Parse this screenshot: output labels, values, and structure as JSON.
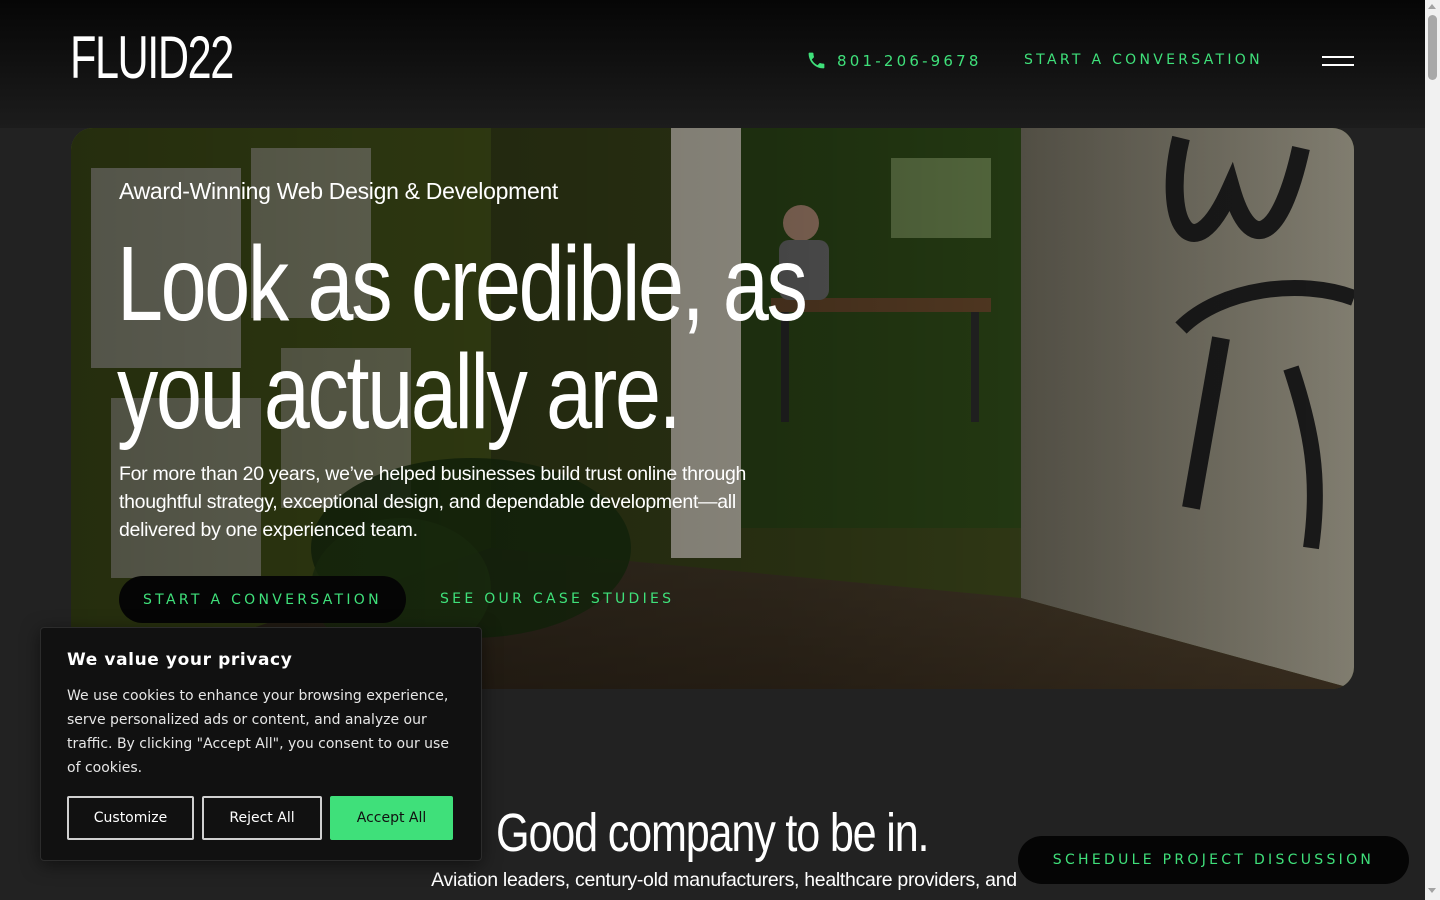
{
  "header": {
    "logo_text": "FLUID22",
    "phone_icon": "phone-icon",
    "phone_number": "801-206-9678",
    "nav_cta": "START A CONVERSATION",
    "menu_icon": "hamburger-menu-icon"
  },
  "hero": {
    "eyebrow": "Award-Winning Web Design & Development",
    "headline_line1": "Look as credible, as",
    "headline_line2": "you actually are.",
    "description": "For more than 20 years, we’ve helped businesses build trust online through thoughtful strategy, exceptional design, and dependable development—all delivered by one experienced team.",
    "primary_button": "START A CONVERSATION",
    "secondary_link": "SEE OUR CASE STUDIES",
    "background_image": "office photo with green wall and man working at desk"
  },
  "clients": {
    "title": "Good company to be in.",
    "description": "Aviation leaders, century-old manufacturers, healthcare providers, and"
  },
  "cookie_banner": {
    "title": "We value your privacy",
    "text": "We use cookies to enhance your browsing experience, serve personalized ads or content, and analyze our traffic. By clicking \"Accept All\", you consent to our use of cookies.",
    "customize_label": "Customize",
    "reject_label": "Reject All",
    "accept_label": "Accept All"
  },
  "floating_cta": "SCHEDULE PROJECT DISCUSSION",
  "colors": {
    "accent": "#3fe07a",
    "background": "#222222",
    "header_background": "#0a0a0a",
    "button_dark": "#050505"
  }
}
